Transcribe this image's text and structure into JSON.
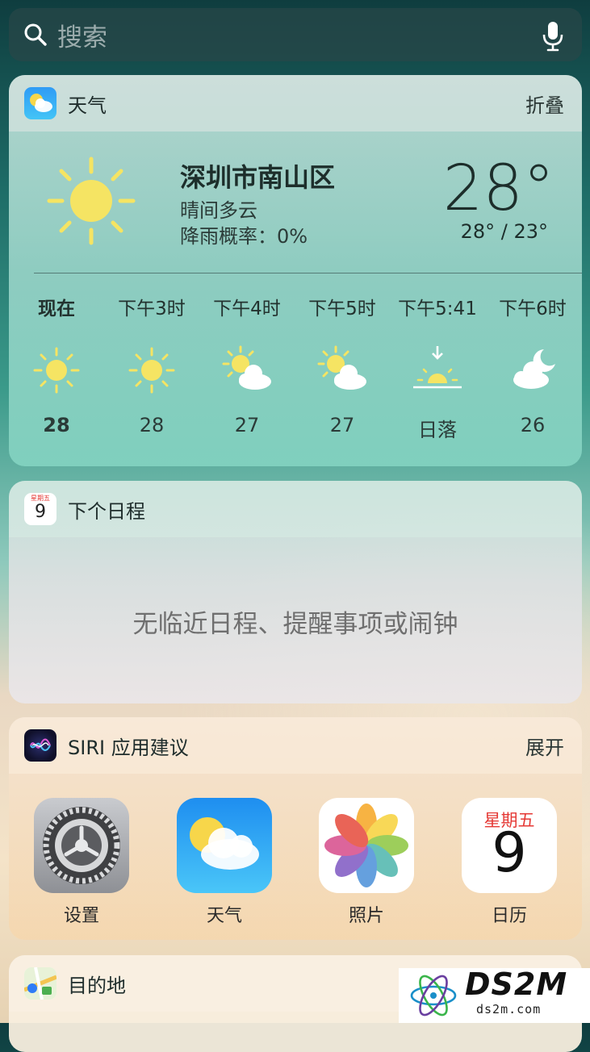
{
  "search": {
    "placeholder": "搜索"
  },
  "weather_widget": {
    "title": "天气",
    "action": "折叠",
    "location": "深圳市南山区",
    "condition": "晴间多云",
    "rain_chance": "降雨概率：0%",
    "temperature": "28°",
    "high_low": "28° / 23°",
    "hourly": [
      {
        "label": "现在",
        "icon": "sun-icon",
        "value": "28"
      },
      {
        "label": "下午3时",
        "icon": "sun-icon",
        "value": "28"
      },
      {
        "label": "下午4时",
        "icon": "partly-cloudy-icon",
        "value": "27"
      },
      {
        "label": "下午5时",
        "icon": "partly-cloudy-icon",
        "value": "27"
      },
      {
        "label": "下午5:41",
        "icon": "sunset-icon",
        "value": "日落"
      },
      {
        "label": "下午6时",
        "icon": "moon-cloud-icon",
        "value": "26"
      }
    ]
  },
  "calendar_widget": {
    "title": "下个日程",
    "icon_day": "星期五",
    "icon_date": "9",
    "empty_message": "无临近日程、提醒事项或闹钟"
  },
  "siri_widget": {
    "title": "SIRI 应用建议",
    "action": "展开",
    "apps": [
      {
        "name": "设置",
        "icon": "settings-icon"
      },
      {
        "name": "天气",
        "icon": "weather-icon"
      },
      {
        "name": "照片",
        "icon": "photos-icon"
      },
      {
        "name": "日历",
        "icon": "calendar-icon",
        "day": "星期五",
        "date": "9"
      }
    ]
  },
  "destination_widget": {
    "title": "目的地"
  },
  "watermark": {
    "brand": "DS2M",
    "url": "ds2m.com"
  },
  "colors": {
    "sun": "#f5e463",
    "calendar_red": "#e53935",
    "weather_blue": "#1e8ef0"
  }
}
